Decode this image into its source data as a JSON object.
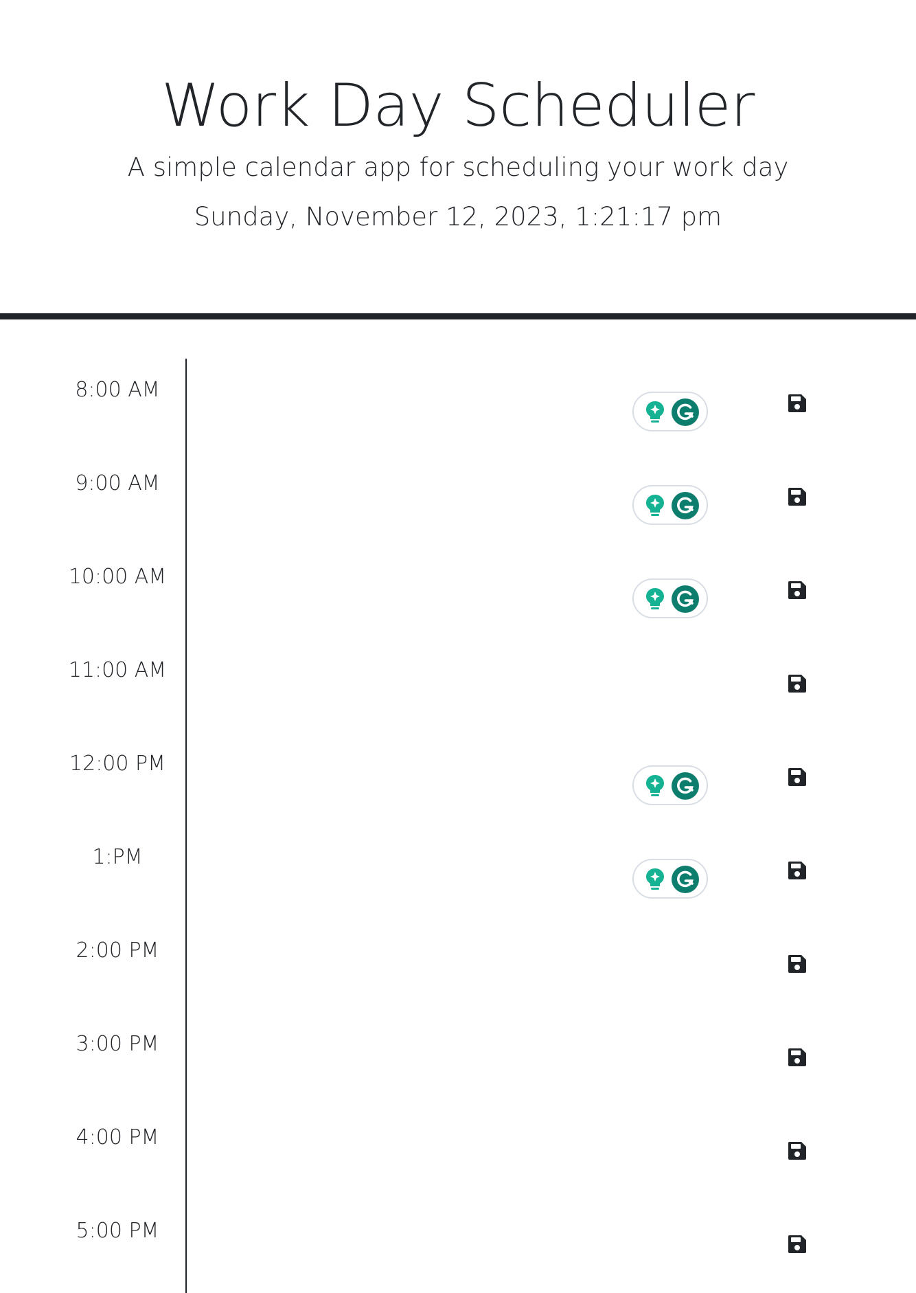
{
  "header": {
    "title": "Work Day Scheduler",
    "subtitle": "A simple calendar app for scheduling your work day",
    "datetime": "Sunday, November 12, 2023, 1:21:17 pm"
  },
  "colors": {
    "text": "#212529",
    "grammarly_dark": "#0d7d6d",
    "grammarly_light": "#15b394"
  },
  "icons": {
    "save": "floppy-disk-icon",
    "bulb": "lightbulb-sparkle-icon",
    "grammarly": "grammarly-g-icon"
  },
  "hours": [
    {
      "label": "8:00 AM",
      "description": "",
      "grammarly_widget": true
    },
    {
      "label": "9:00 AM",
      "description": "",
      "grammarly_widget": true
    },
    {
      "label": "10:00 AM",
      "description": "",
      "grammarly_widget": true
    },
    {
      "label": "11:00 AM",
      "description": "",
      "grammarly_widget": false
    },
    {
      "label": "12:00 PM",
      "description": "",
      "grammarly_widget": true
    },
    {
      "label": "1:PM",
      "description": "",
      "grammarly_widget": true
    },
    {
      "label": "2:00 PM",
      "description": "",
      "grammarly_widget": false
    },
    {
      "label": "3:00 PM",
      "description": "",
      "grammarly_widget": false
    },
    {
      "label": "4:00 PM",
      "description": "",
      "grammarly_widget": false
    },
    {
      "label": "5:00 PM",
      "description": "",
      "grammarly_widget": false
    }
  ]
}
